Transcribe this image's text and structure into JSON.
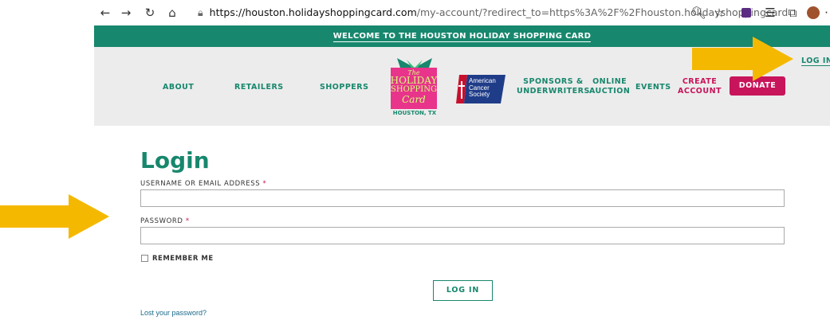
{
  "browser": {
    "url_host": "https://houston.holidayshoppingcard.com",
    "url_rest": "/my-account/?redirect_to=https%3A%2F%2Fhouston.holidayshoppingcard.com...",
    "icons": [
      "back-icon",
      "forward-icon",
      "refresh-icon",
      "home-icon",
      "lock-icon",
      "zoom-icon",
      "favorite-icon",
      "extension-icon",
      "favorites-bar-icon",
      "collections-icon",
      "profile-avatar",
      "more-icon"
    ]
  },
  "banner": {
    "text": "WELCOME TO THE HOUSTON HOLIDAY SHOPPING CARD"
  },
  "nav": {
    "about": "ABOUT",
    "retailers": "RETAILERS",
    "shoppers": "SHOPPERS",
    "sponsors_line1": "SPONSORS &",
    "sponsors_line2": "UNDERWRITERS",
    "auction_line1": "ONLINE",
    "auction_line2": "AUCTION",
    "events": "EVENTS",
    "create_line1": "CREATE",
    "create_line2": "ACCOUNT",
    "donate": "DONATE",
    "login": "LOG IN"
  },
  "logo": {
    "line1": "The",
    "line2": "HOLIDAY",
    "line3": "SHOPPING",
    "line4": "Card",
    "city": "HOUSTON, TX"
  },
  "sponsor_logo": {
    "line1": "American",
    "line2": "Cancer",
    "line3": "Society"
  },
  "form": {
    "title": "Login",
    "username_label": "USERNAME OR EMAIL ADDRESS",
    "password_label": "PASSWORD",
    "required_mark": "*",
    "username_value": "",
    "password_value": "",
    "remember_label": "REMEMBER ME",
    "remember_checked": false,
    "submit_label": "LOG IN",
    "lost_password": "Lost your password?"
  },
  "colors": {
    "brand_green": "#17876d",
    "brand_pink": "#c8145a",
    "arrow_yellow": "#f5b800"
  }
}
